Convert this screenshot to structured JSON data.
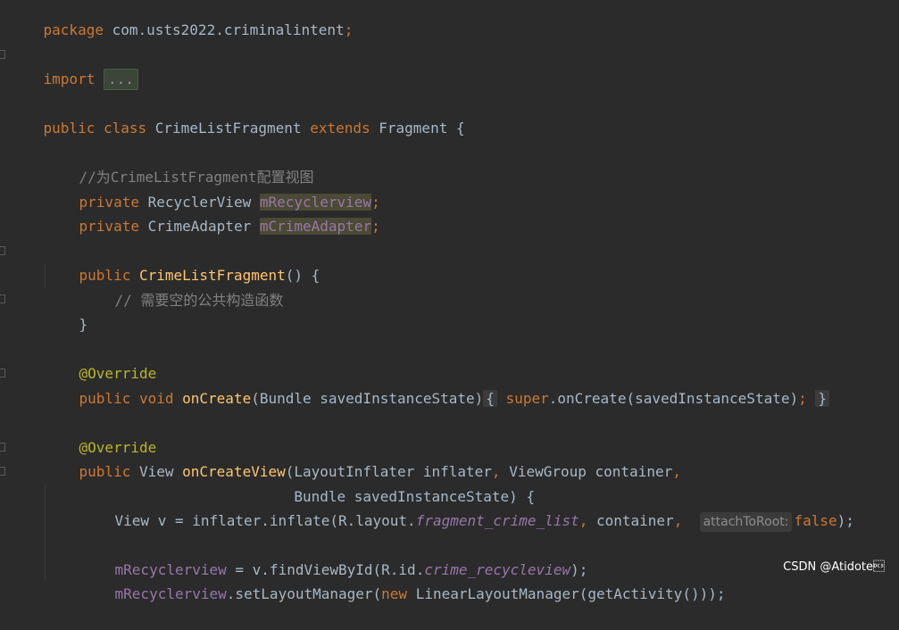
{
  "code": {
    "l1": {
      "kw": "package",
      "rest": " com.usts2022.criminalintent",
      "semi": ";"
    },
    "l2": {
      "kw": "import",
      "fold": "..."
    },
    "l3": {
      "kw1": "public",
      "kw2": "class",
      "name": "CrimeListFragment",
      "kw3": "extends",
      "parent": "Fragment {"
    },
    "l4": {
      "comment": "//为CrimeListFragment配置视图"
    },
    "l5": {
      "kw": "private",
      "type": "RecyclerView",
      "field": "mRecyclerview",
      "semi": ";"
    },
    "l6": {
      "kw": "private",
      "type": "CrimeAdapter",
      "field": "mCrimeAdapter",
      "semi": ";"
    },
    "l7": {
      "kw": "public",
      "fn": "CrimeListFragment",
      "rest": "() {"
    },
    "l8": {
      "comment": "// 需要空的公共构造函数"
    },
    "l9": {
      "brace": "}"
    },
    "l10": {
      "ann": "@Override"
    },
    "l11": {
      "kw1": "public",
      "kw2": "void",
      "fn": "onCreate",
      "params": "(Bundle savedInstanceState)",
      "ob": "{",
      "kw3": "super",
      "call": ".onCreate(savedInstanceState)",
      "semi": ";",
      "cb": "}"
    },
    "l12": {
      "ann": "@Override"
    },
    "l13": {
      "kw": "public",
      "type": "View",
      "fn": "onCreateView",
      "p1": "(LayoutInflater inflater",
      "comma1": ",",
      "p2": " ViewGroup container",
      "comma2": ","
    },
    "l14": {
      "indent": "                         ",
      "p": "Bundle savedInstanceState) {"
    },
    "l15": {
      "a": "View v = inflater.inflate(R.layout.",
      "it": "fragment_crime_list",
      "comma": ",",
      "b": " container",
      "comma2": ",",
      "hint": "attachToRoot:",
      "kw": "false",
      "end": ");"
    },
    "l16": {
      "field": "mRecyclerview",
      "a": " = v.findViewById(R.id.",
      "it": "crime_recycleview",
      "end": ");"
    },
    "l17": {
      "field": "mRecyclerview",
      "a": ".setLayoutManager(",
      "kw": "new",
      "b": " LinearLayoutManager(getActivity()));"
    }
  },
  "watermark": "CSDN @Atidote\u0013"
}
